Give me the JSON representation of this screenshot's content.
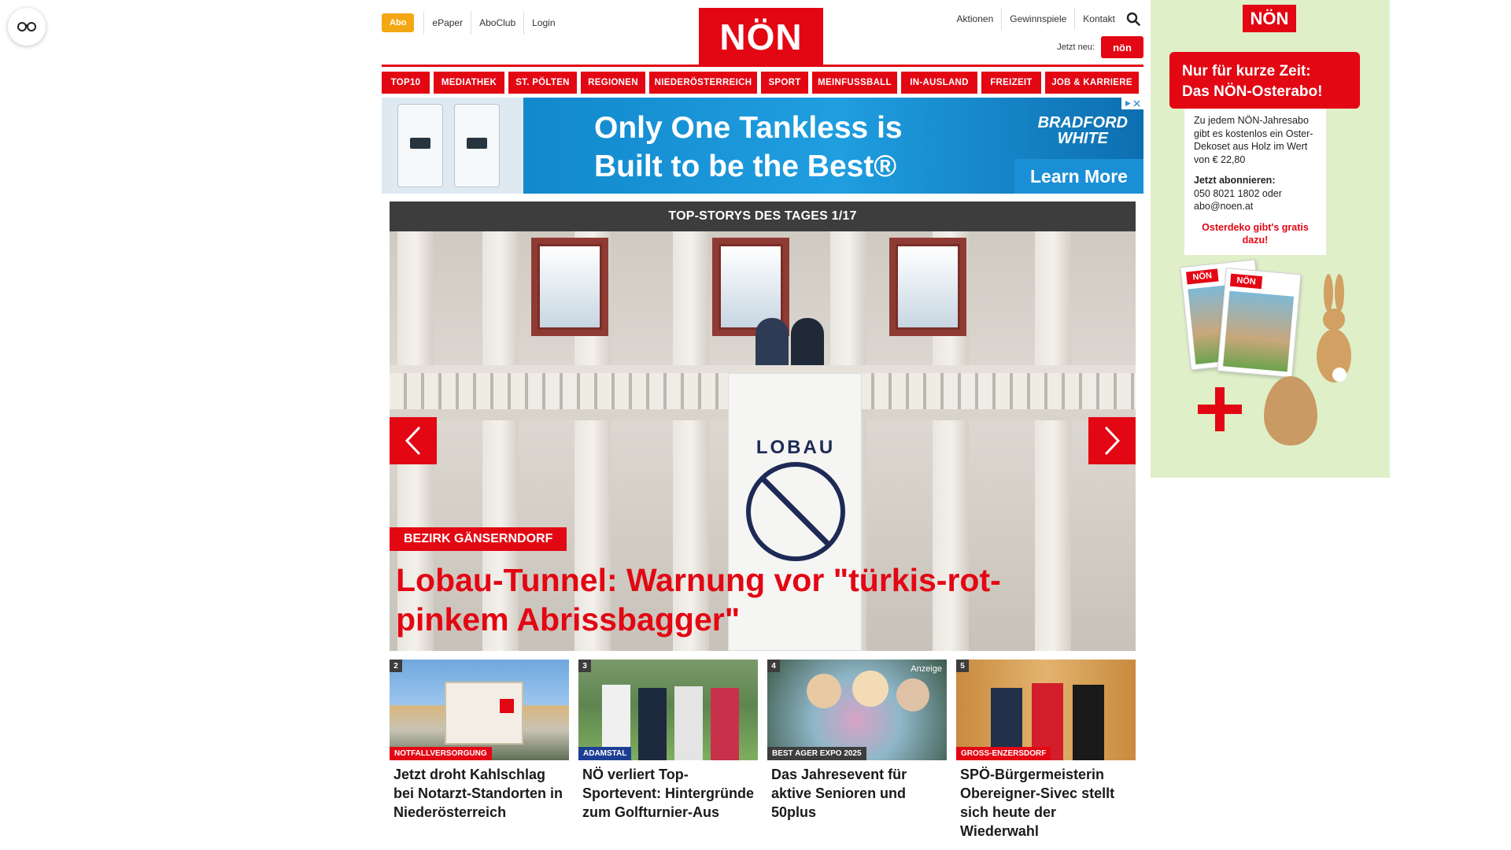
{
  "header": {
    "abo_label": "Abo",
    "top_links": [
      "ePaper",
      "AboClub",
      "Login"
    ],
    "logo_text": "NÖN",
    "right_links": [
      "Aktionen",
      "Gewinnspiele",
      "Kontakt"
    ],
    "jetzt_neu_label": "Jetzt neu:",
    "jetzt_neu_logo": "nön"
  },
  "nav": [
    {
      "label": "TOP10",
      "width": 61
    },
    {
      "label": "MEDIATHEK",
      "width": 90
    },
    {
      "label": "ST. PÖLTEN",
      "width": 87
    },
    {
      "label": "REGIONEN",
      "width": 82
    },
    {
      "label": "NIEDERÖSTERREICH",
      "width": 137
    },
    {
      "label": "SPORT",
      "width": 60
    },
    {
      "label": "MEINFUSSBALL",
      "width": 108
    },
    {
      "label": "IN-AUSLAND",
      "width": 97
    },
    {
      "label": "FREIZEIT",
      "width": 76
    },
    {
      "label": "JOB & KARRIERE",
      "width": 119
    }
  ],
  "banner_ad": {
    "headline_1": "Only One Tankless is",
    "headline_2": "Built to be the Best®",
    "brand_1": "BRADFORD",
    "brand_2": "WHITE",
    "cta": "Learn More"
  },
  "carousel": {
    "heading": "TOP-STORYS DES TAGES 1/17",
    "category": "BEZIRK GÄNSERNDORF",
    "title": "Lobau-Tunnel: Warnung vor \"türkis-rot-pinkem Abrissbagger\"",
    "flag_text": "LOBAU"
  },
  "teasers": [
    {
      "num": "2",
      "category": "NOTFALLVERSORGUNG",
      "title": "Jetzt droht Kahlschlag bei Notarzt-Standorten in Niederösterreich",
      "cat_color": "#e30613"
    },
    {
      "num": "3",
      "category": "ADAMSTAL",
      "title": "NÖ verliert Top-Sportevent: Hintergründe zum Golfturnier-Aus",
      "cat_color": "#1c3f94"
    },
    {
      "num": "4",
      "category": "BEST AGER EXPO 2025",
      "title": "Das Jahresevent für aktive Senioren und 50plus",
      "cat_color": "#3d3d3d",
      "anzeige": "Anzeige"
    },
    {
      "num": "5",
      "category": "GROSS-ENZERSDORF",
      "title": "SPÖ-Bürgermeisterin Obereigner-Sivec stellt sich heute der Wiederwahl",
      "cat_color": "#e30613"
    }
  ],
  "side_ad": {
    "logo": "NÖN",
    "banner_1": "Nur für kurze Zeit:",
    "banner_2": "Das NÖN-Osterabo!",
    "text": "Zu jedem NÖN-Jahresabo gibt es kostenlos ein Oster-Dekoset aus Holz im Wert von € 22,80",
    "subscribe_label": "Jetzt abonnieren:",
    "contact": "050 8021 1802 oder abo@noen.at",
    "promo": "Osterdeko gibt's gratis dazu!",
    "mag_logo": "NÖN"
  },
  "colors": {
    "brand_red": "#e30613",
    "abo_orange": "#f3a712",
    "dark_bar": "#3d3d3d"
  }
}
